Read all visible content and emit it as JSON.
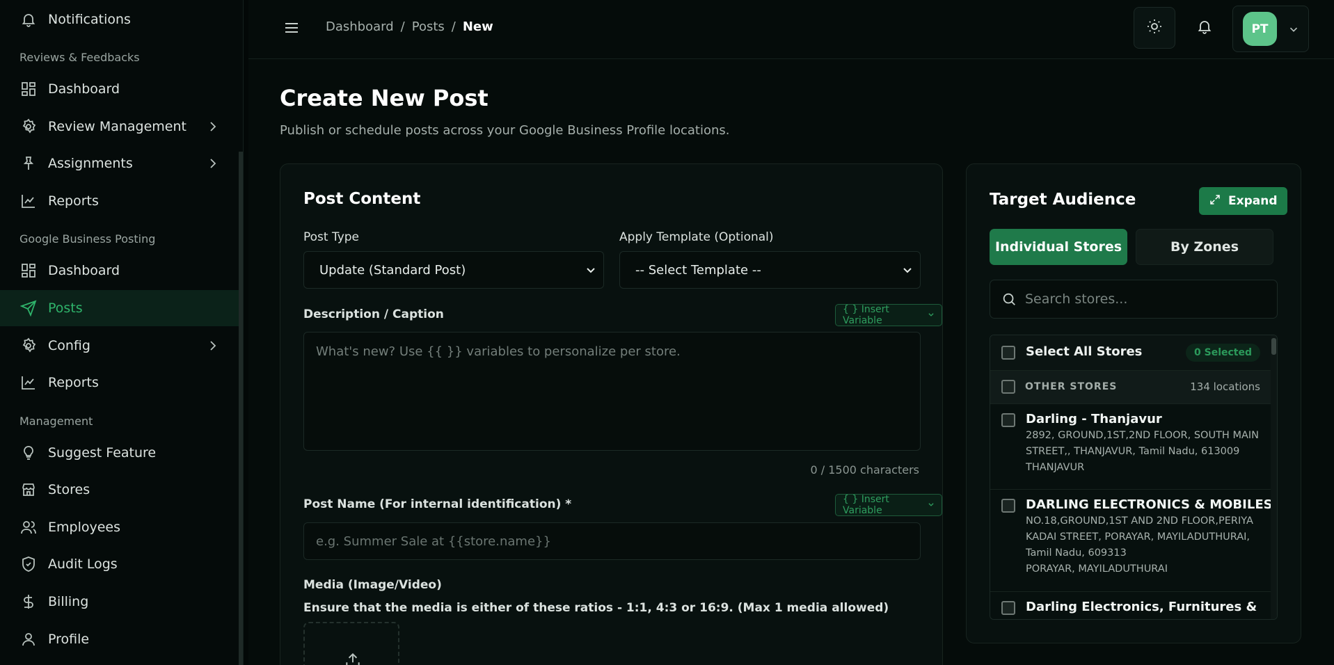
{
  "sidebar": {
    "top_item": {
      "label": "Notifications",
      "icon": "bell-icon"
    },
    "sections": [
      {
        "label": "Reviews & Feedbacks"
      },
      {
        "label": "Google Business Posting"
      },
      {
        "label": "Management"
      }
    ],
    "items": [
      {
        "label": "Dashboard",
        "icon": "dashboard-icon"
      },
      {
        "label": "Review Management",
        "icon": "gear-icon",
        "expandable": true
      },
      {
        "label": "Assignments",
        "icon": "pin-icon",
        "expandable": true
      },
      {
        "label": "Reports",
        "icon": "chart-icon"
      },
      {
        "label": "Dashboard",
        "icon": "dashboard-icon"
      },
      {
        "label": "Posts",
        "icon": "send-icon",
        "active": true
      },
      {
        "label": "Config",
        "icon": "gear-icon",
        "expandable": true
      },
      {
        "label": "Reports",
        "icon": "chart-icon"
      },
      {
        "label": "Suggest Feature",
        "icon": "lightbulb-icon"
      },
      {
        "label": "Stores",
        "icon": "store-icon"
      },
      {
        "label": "Employees",
        "icon": "users-icon"
      },
      {
        "label": "Audit Logs",
        "icon": "shield-check-icon"
      },
      {
        "label": "Billing",
        "icon": "dollar-icon"
      },
      {
        "label": "Profile",
        "icon": "user-icon"
      }
    ]
  },
  "header": {
    "breadcrumb": [
      "Dashboard",
      "Posts",
      "New"
    ],
    "breadcrumb_sep": "/",
    "avatar_initials": "PT"
  },
  "page": {
    "title": "Create New Post",
    "subtitle": "Publish or schedule posts across your Google Business Profile locations."
  },
  "post_content": {
    "title": "Post Content",
    "post_type_label": "Post Type",
    "post_type_value": "Update (Standard Post)",
    "template_label": "Apply Template (Optional)",
    "template_value": "-- Select Template --",
    "description_label": "Description / Caption",
    "insert_variable": "{ } Insert Variable",
    "description_placeholder": "What's new? Use {{ }} variables to personalize per store.",
    "char_counter": "0 / 1500 characters",
    "post_name_label": "Post Name (For internal identification) *",
    "post_name_placeholder": "e.g. Summer Sale at {{store.name}}",
    "media_label": "Media (Image/Video)",
    "media_hint": "Ensure that the media is either of these ratios - 1:1, 4:3 or 16:9. (Max 1 media allowed)"
  },
  "target_audience": {
    "title": "Target Audience",
    "expand_label": "Expand",
    "tab_individual": "Individual Stores",
    "tab_zones": "By Zones",
    "search_placeholder": "Search stores...",
    "select_all_label": "Select All Stores",
    "selected_badge": "0 Selected",
    "group_label": "OTHER STORES",
    "group_count": "134 locations",
    "stores": [
      {
        "name": "Darling - Thanjavur",
        "address": [
          "2892, GROUND,1ST,2ND FLOOR, SOUTH MAIN",
          "STREET,, THANJAVUR, Tamil Nadu, 613009",
          "THANJAVUR"
        ]
      },
      {
        "name": "DARLING ELECTRONICS & MOBILES",
        "address": [
          "NO.18,GROUND,1ST AND 2ND FLOOR,PERIYA",
          "KADAI STREET, PORAYAR, MAYILADUTHURAI,",
          "Tamil Nadu, 609313",
          "PORAYAR, MAYILADUTHURAI"
        ]
      },
      {
        "name": "Darling Electronics, Furnitures &",
        "address": []
      }
    ]
  },
  "colors": {
    "accent": "#1f7a4a",
    "active_text": "#2fb46b",
    "background": "#050c0a"
  }
}
